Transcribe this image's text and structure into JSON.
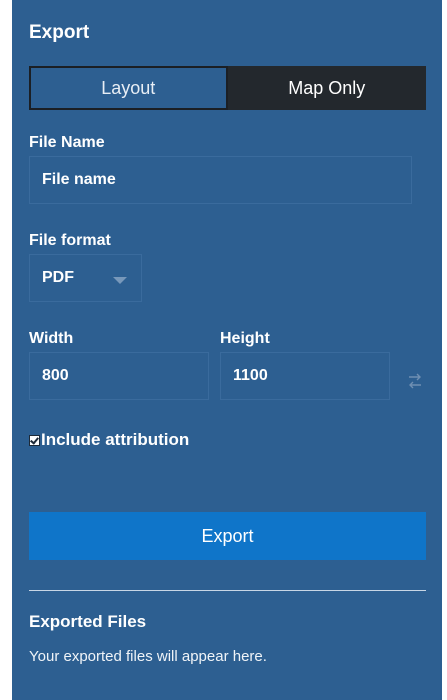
{
  "panel": {
    "title": "Export"
  },
  "tabs": [
    {
      "label": "Layout",
      "selected": false
    },
    {
      "label": "Map Only",
      "selected": true
    }
  ],
  "file_name": {
    "label": "File Name",
    "value": "File name"
  },
  "file_format": {
    "label": "File format",
    "selected": "PDF"
  },
  "width": {
    "label": "Width",
    "value": "800"
  },
  "height": {
    "label": "Height",
    "value": "1100"
  },
  "attribution": {
    "label": "Include attribution",
    "checked": true
  },
  "export_button": {
    "label": "Export"
  },
  "exported_files": {
    "title": "Exported Files",
    "message": "Your exported files will appear here."
  },
  "colors": {
    "panel_bg": "#2d5f91",
    "active_tab": "#23282d",
    "primary_button": "#0f75c9"
  },
  "icons": {
    "format_dropdown": "chevron-down-icon",
    "swap_dimensions": "swap-icon",
    "attribution_checkbox": "checkbox-checked-icon"
  }
}
